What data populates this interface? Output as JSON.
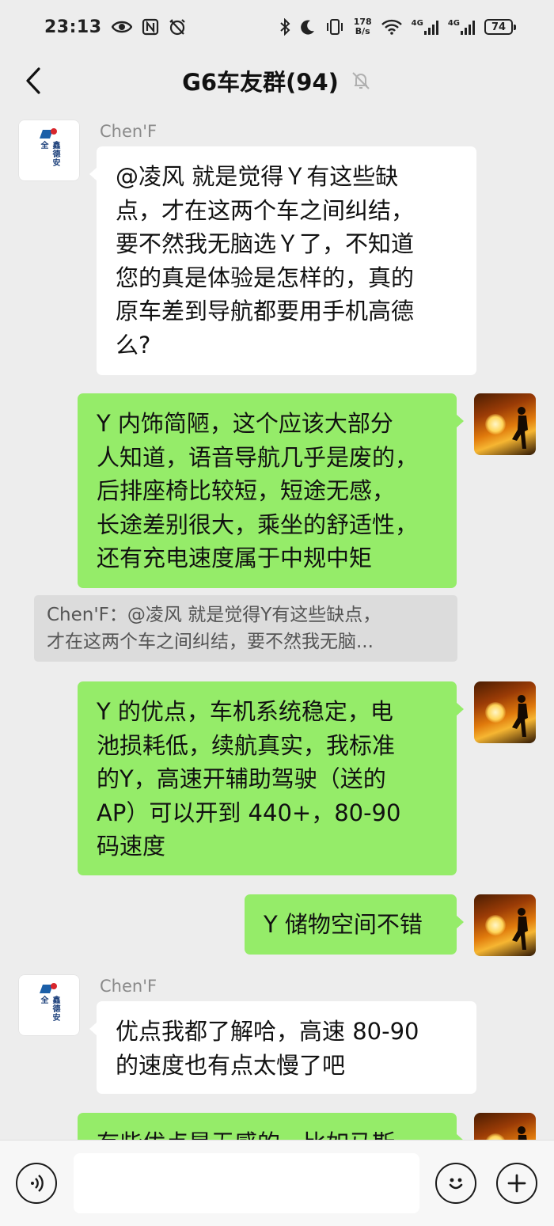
{
  "status_bar": {
    "time": "23:13",
    "net_speed_top": "178",
    "net_speed_bottom": "B/s",
    "network_1": "4G",
    "network_2": "4G",
    "battery": "74"
  },
  "header": {
    "title": "G6车友群(94)",
    "back_icon": "chevron-left-icon",
    "mute_icon": "bell-muted-icon"
  },
  "messages": [
    {
      "side": "left",
      "sender": "Chen'F",
      "avatar": "xinde-safety-logo",
      "lines": [
        "@凌风  就是觉得Ｙ有这些缺",
        "点，才在这两个车之间纠结，",
        "要不然我无脑选Ｙ了，不知道",
        "您的真是体验是怎样的，真的",
        "原车差到导航都要用手机高德",
        "么?"
      ]
    },
    {
      "side": "right",
      "avatar": "sunset-silhouette",
      "lines": [
        "Y 内饰简陋，这个应该大部分",
        "人知道，语音导航几乎是废的，",
        "后排座椅比较短，短途无感，",
        "长途差别很大，乘坐的舒适性，",
        "还有充电速度属于中规中矩"
      ]
    },
    {
      "side": "quote",
      "lines": [
        "Chen'F：@凌风 就是觉得Y有这些缺点，",
        "才在这两个车之间纠结，要不然我无脑..."
      ]
    },
    {
      "side": "right",
      "avatar": "sunset-silhouette",
      "lines": [
        "Y 的优点，车机系统稳定，电",
        "池损耗低，续航真实，我标准",
        "的Y，高速开辅助驾驶（送的",
        "AP）可以开到 440+，80-90",
        "码速度"
      ]
    },
    {
      "side": "right",
      "avatar": "sunset-silhouette",
      "lines": [
        "Y 储物空间不错"
      ]
    },
    {
      "side": "left",
      "sender": "Chen'F",
      "avatar": "xinde-safety-logo",
      "lines": [
        "优点我都了解哈，高速 80-90",
        "的速度也有点太慢了吧"
      ]
    },
    {
      "side": "right",
      "avatar": "sunset-silhouette",
      "lines": [
        "有些优点是无感的，比如马斯"
      ]
    }
  ],
  "logo_text": "鑫德安全",
  "input_bar": {
    "voice_icon": "voice-icon",
    "emoji_icon": "emoji-icon",
    "plus_icon": "plus-icon",
    "placeholder": ""
  },
  "colors": {
    "background": "#ededed",
    "bubble_green": "#95ec69",
    "bubble_white": "#ffffff"
  }
}
